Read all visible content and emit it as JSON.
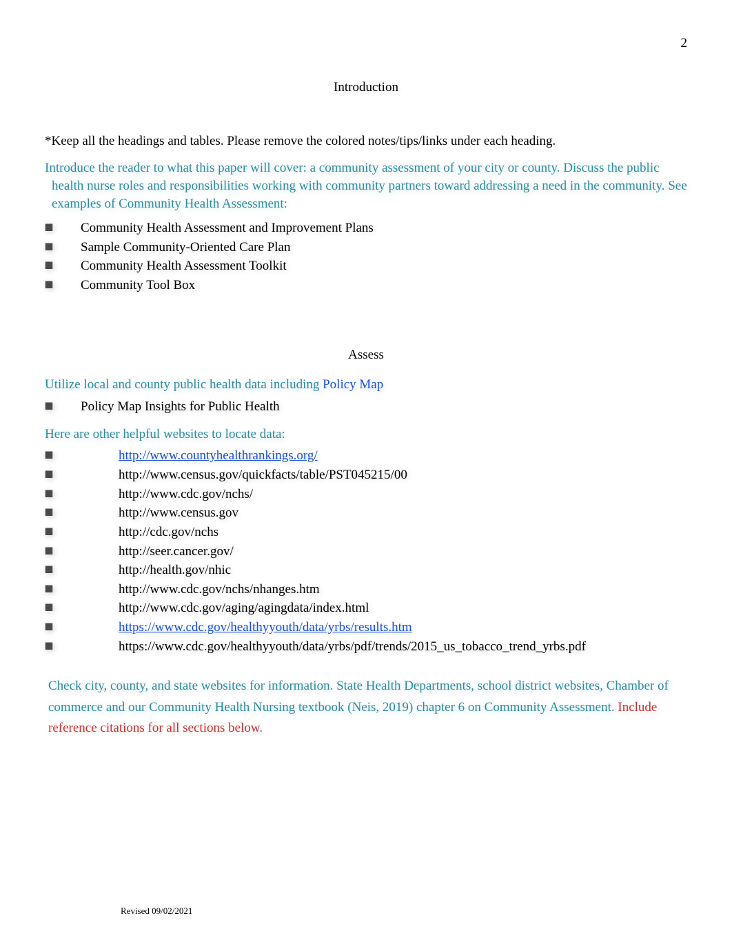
{
  "pageNumber": "2",
  "headings": {
    "intro": "Introduction",
    "assess": "Assess"
  },
  "intro": {
    "keepNote": "*Keep all the headings and tables.  Please remove the colored notes/tips/links under each heading.",
    "tealNote": "Introduce the reader to what this paper will cover: a community assessment of your city or county. Discuss the public health nurse roles and responsibilities working with community partners toward addressing a need in the community. See examples of Community Health Assessment:",
    "bullets": [
      "Community Health Assessment and Improvement Plans",
      "Sample Community-Oriented Care Plan",
      "Community Health Assessment Toolkit",
      "Community Tool Box"
    ]
  },
  "assess": {
    "lead": "Utilize local and county public health data including",
    "policyMap": " Policy Map",
    "bullet1": "Policy Map Insights for Public Health",
    "helpful": "Here are other helpful websites to locate data:",
    "links": [
      {
        "text": "http://www.countyhealthrankings.org/",
        "style": "blue-u"
      },
      {
        "text": "http://www.census.gov/quickfacts/table/PST045215/00",
        "style": "plain"
      },
      {
        "text": "http://www.cdc.gov/nchs/",
        "style": "plain"
      },
      {
        "text": "http://www.census.gov",
        "style": "plain"
      },
      {
        "text": "http://cdc.gov/nchs",
        "style": "plain"
      },
      {
        "text": "http://seer.cancer.gov/",
        "style": "plain"
      },
      {
        "text": "http://health.gov/nhic",
        "style": "plain"
      },
      {
        "text": "http://www.cdc.gov/nchs/nhanges.htm",
        "style": "plain"
      },
      {
        "text": "http://www.cdc.gov/aging/agingdata/index.html",
        "style": "plain"
      },
      {
        "text": "https://www.cdc.gov/healthyyouth/data/yrbs/results.htm",
        "style": "blue-u"
      },
      {
        "text": "https://www.cdc.gov/healthyyouth/data/yrbs/pdf/trends/2015_us_tobacco_trend_yrbs.pdf",
        "style": "plain"
      }
    ],
    "closingTeal": "Check city, county, and state websites for information. State Health Departments, school district websites, Chamber of commerce and our Community Health Nursing textbook (Neis, 2019) chapter 6 on Community Assessment.  ",
    "closingRed": "Include reference citations for all sections below",
    "closingDot": "."
  },
  "footer": "Revised 09/02/2021",
  "marker": "⯀"
}
